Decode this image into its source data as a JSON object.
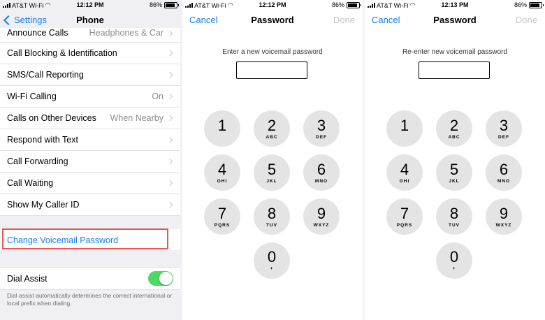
{
  "status": {
    "carrier": "AT&T Wi-Fi",
    "battery": "86%",
    "times": [
      "12:12 PM",
      "12:12 PM",
      "12:13 PM"
    ]
  },
  "settings": {
    "back_label": "Settings",
    "title": "Phone",
    "rows": [
      {
        "label": "Announce Calls",
        "value": "Headphones & Car"
      },
      {
        "label": "Call Blocking & Identification",
        "value": ""
      },
      {
        "label": "SMS/Call Reporting",
        "value": ""
      },
      {
        "label": "Wi-Fi Calling",
        "value": "On"
      },
      {
        "label": "Calls on Other Devices",
        "value": "When Nearby"
      },
      {
        "label": "Respond with Text",
        "value": ""
      },
      {
        "label": "Call Forwarding",
        "value": ""
      },
      {
        "label": "Call Waiting",
        "value": ""
      },
      {
        "label": "Show My Caller ID",
        "value": ""
      }
    ],
    "voicemail_label": "Change Voicemail Password",
    "dial_assist_label": "Dial Assist",
    "dial_assist_on": true,
    "dial_assist_note": "Dial assist automatically determines the correct international or local prefix when dialing."
  },
  "password_screens": [
    {
      "cancel": "Cancel",
      "title": "Password",
      "done": "Done",
      "prompt": "Enter a new voicemail password",
      "value": ""
    },
    {
      "cancel": "Cancel",
      "title": "Password",
      "done": "Done",
      "prompt": "Re-enter new voicemail password",
      "value": ""
    }
  ],
  "keypad": [
    {
      "digit": "1",
      "letters": ""
    },
    {
      "digit": "2",
      "letters": "ABC"
    },
    {
      "digit": "3",
      "letters": "DEF"
    },
    {
      "digit": "4",
      "letters": "GHI"
    },
    {
      "digit": "5",
      "letters": "JKL"
    },
    {
      "digit": "6",
      "letters": "MNO"
    },
    {
      "digit": "7",
      "letters": "PQRS"
    },
    {
      "digit": "8",
      "letters": "TUV"
    },
    {
      "digit": "9",
      "letters": "WXYZ"
    },
    {
      "digit": "0",
      "letters": "+"
    }
  ],
  "colors": {
    "link": "#1a7ef2",
    "toggle_on": "#4cd964",
    "highlight": "#e8574f"
  }
}
